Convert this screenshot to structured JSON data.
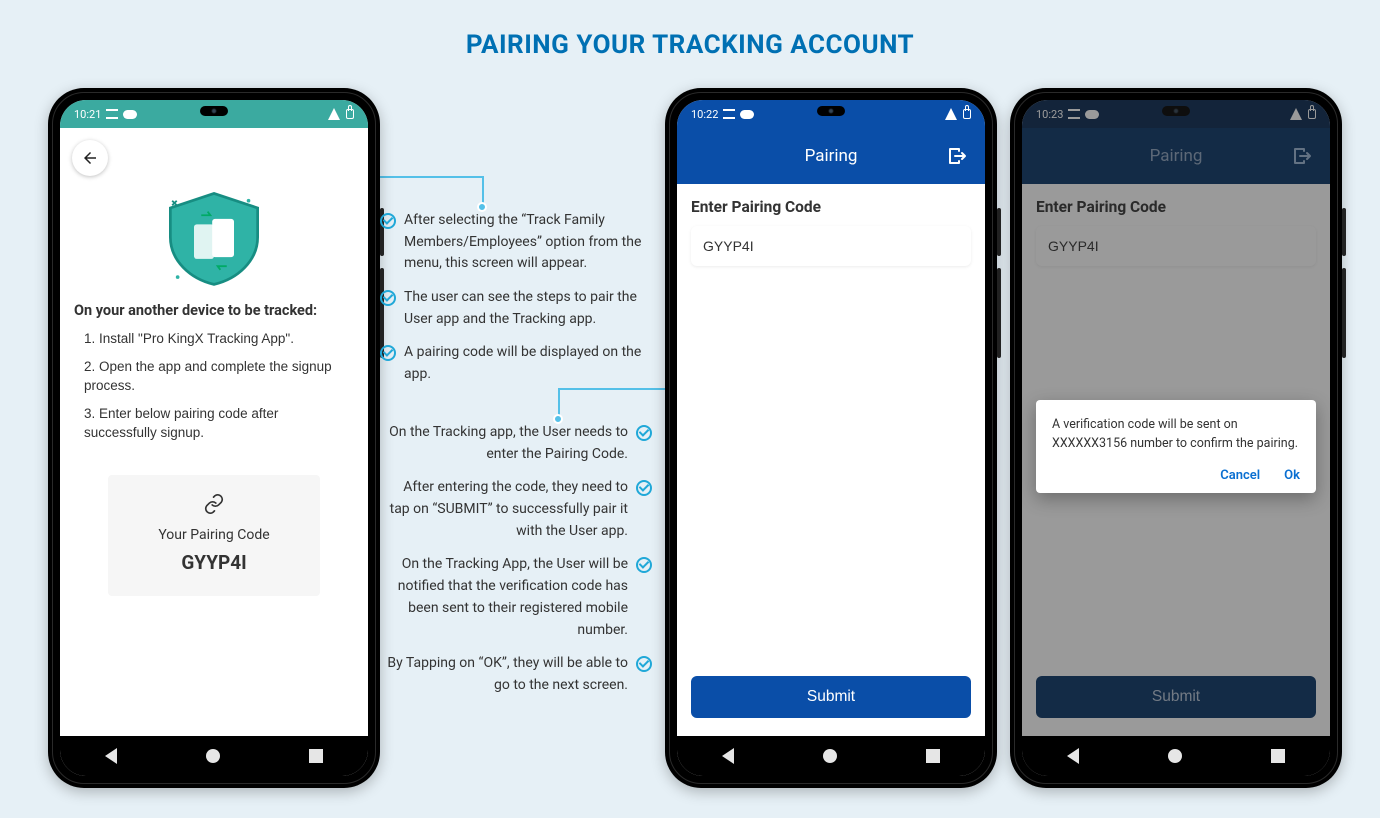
{
  "page_title": "PAIRING YOUR TRACKING ACCOUNT",
  "phone1": {
    "time": "10:21",
    "heading": "On your another device to be tracked:",
    "steps": [
      "1. Install \"Pro KingX Tracking App\".",
      "2. Open the app and complete the signup process.",
      "3. Enter below pairing code after successfully signup."
    ],
    "code_title": "Your Pairing Code",
    "code_value": "GYYP4I"
  },
  "phone2": {
    "time": "10:22",
    "header": "Pairing",
    "label": "Enter Pairing Code",
    "code_value": "GYYP4I",
    "submit": "Submit"
  },
  "phone3": {
    "time": "10:23",
    "header": "Pairing",
    "label": "Enter Pairing Code",
    "code_value": "GYYP4I",
    "submit": "Submit",
    "dialog_msg": "A verification code will be sent on XXXXXX3156 number to confirm the pairing.",
    "cancel": "Cancel",
    "ok": "Ok"
  },
  "annotations_left": [
    "After selecting the “Track Family Members/Employees” option from the menu, this screen will appear.",
    "The user can see the steps to pair the User app and the Tracking app.",
    "A pairing code will be displayed on the app."
  ],
  "annotations_right": [
    "On the Tracking app, the User needs to enter the Pairing Code.",
    "After entering the code, they need to tap on “SUBMIT” to successfully pair it with the User app.",
    "On the Tracking App, the User will be notified that the verification code has been sent to their registered mobile number.",
    "By Tapping on “OK”, they will be able to go to the next screen."
  ]
}
